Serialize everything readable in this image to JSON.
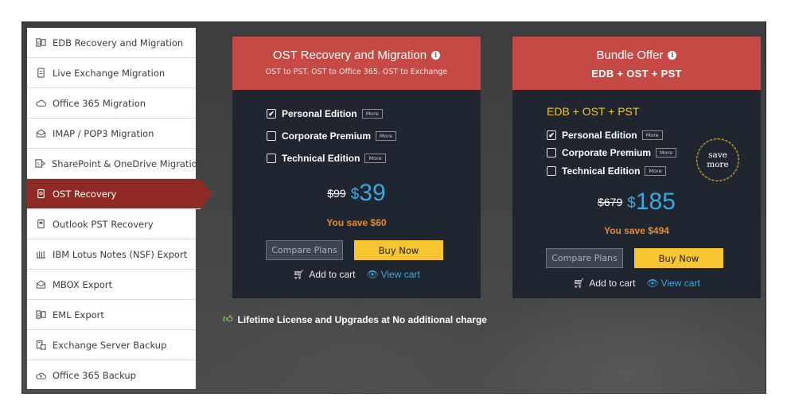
{
  "sidebar": {
    "items": [
      {
        "label": "EDB Recovery and Migration",
        "icon": "edb-icon"
      },
      {
        "label": "Live Exchange Migration",
        "icon": "server-icon"
      },
      {
        "label": "Office 365 Migration",
        "icon": "cloud-icon"
      },
      {
        "label": "IMAP / POP3 Migration",
        "icon": "envelope-icon"
      },
      {
        "label": "SharePoint & OneDrive Migration",
        "icon": "sharepoint-icon"
      },
      {
        "label": "OST Recovery",
        "icon": "ost-icon",
        "active": true
      },
      {
        "label": "Outlook PST Recovery",
        "icon": "pst-icon"
      },
      {
        "label": "IBM Lotus Notes (NSF) Export",
        "icon": "lotus-icon"
      },
      {
        "label": "MBOX Export",
        "icon": "envelope-icon"
      },
      {
        "label": "EML Export",
        "icon": "eml-icon"
      },
      {
        "label": "Exchange Server Backup",
        "icon": "backup-server-icon"
      },
      {
        "label": "Office 365 Backup",
        "icon": "cloud-backup-icon"
      }
    ]
  },
  "card1": {
    "title": "OST Recovery and Migration",
    "subtitle": "OST to PST. OST to Office 365. OST to Exchange",
    "options": [
      {
        "label": "Personal Edition",
        "checked": true,
        "more": "More"
      },
      {
        "label": "Corporate Premium",
        "checked": false,
        "more": "More"
      },
      {
        "label": "Technical Edition",
        "checked": false,
        "more": "More"
      }
    ],
    "old_price": "$99",
    "currency": "$",
    "price": "39",
    "save_text": "You save $60",
    "compare_label": "Compare Plans",
    "buy_label": "Buy Now",
    "add_to_cart": "Add to cart",
    "view_cart": "View cart"
  },
  "card2": {
    "title": "Bundle Offer",
    "subtitle": "EDB + OST + PST",
    "bundle_label": "EDB + OST + PST",
    "options": [
      {
        "label": "Personal Edition",
        "checked": true,
        "more": "More"
      },
      {
        "label": "Corporate Premium",
        "checked": false,
        "more": "More"
      },
      {
        "label": "Technical Edition",
        "checked": false,
        "more": "More"
      }
    ],
    "badge_line1": "save",
    "badge_line2": "more",
    "old_price": "$679",
    "currency": "$",
    "price": "185",
    "save_text": "You save $494",
    "compare_label": "Compare Plans",
    "buy_label": "Buy Now",
    "add_to_cart": "Add to cart",
    "view_cart": "View cart"
  },
  "footer": {
    "lifetime_text": "Lifetime License and Upgrades at No additional charge"
  },
  "colors": {
    "header_red": "#c54a45",
    "active_red": "#8f2a24",
    "card_bg": "#202630",
    "price_blue": "#3aa8e0",
    "save_orange": "#e78b29",
    "buy_yellow": "#f6c531",
    "bundle_gold": "#f0c531"
  }
}
